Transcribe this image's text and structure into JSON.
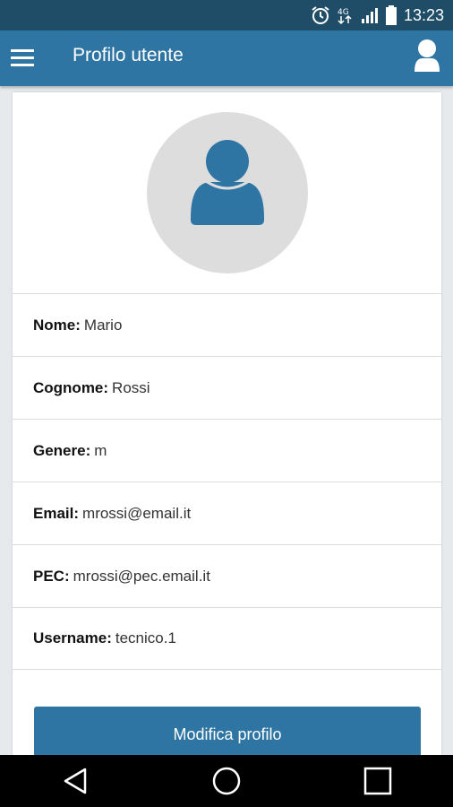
{
  "status_bar": {
    "time": "13:23",
    "network": "4G"
  },
  "app_bar": {
    "title": "Profilo utente"
  },
  "profile": {
    "fields": [
      {
        "label": "Nome:",
        "value": "Mario"
      },
      {
        "label": "Cognome:",
        "value": "Rossi"
      },
      {
        "label": "Genere:",
        "value": "m"
      },
      {
        "label": "Email:",
        "value": "mrossi@email.it"
      },
      {
        "label": "PEC:",
        "value": "mrossi@pec.email.it"
      },
      {
        "label": "Username:",
        "value": "tecnico.1"
      }
    ],
    "edit_button_label": "Modifica profilo"
  },
  "colors": {
    "status_bar": "#1f4d68",
    "primary": "#2e75a3",
    "avatar_bg": "#dddddd",
    "background": "#e6eaed"
  },
  "icons": {
    "status": [
      "alarm-icon",
      "network-4g-icon",
      "signal-icon",
      "battery-icon"
    ],
    "app_bar": [
      "menu-icon",
      "account-icon"
    ],
    "nav": [
      "back-icon",
      "home-icon",
      "recents-icon"
    ]
  }
}
